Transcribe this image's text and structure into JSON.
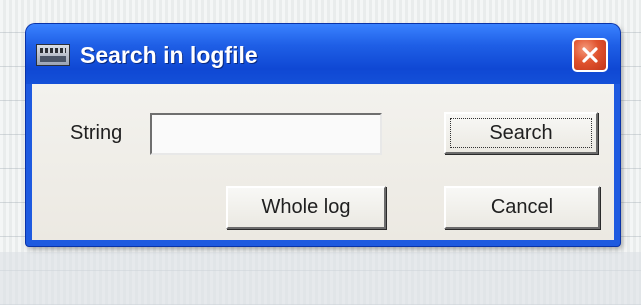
{
  "dialog": {
    "title": "Search in logfile",
    "string_label": "String",
    "string_value": "",
    "buttons": {
      "search": "Search",
      "whole_log": "Whole log",
      "cancel": "Cancel"
    }
  },
  "icons": {
    "app": "app-window-icon",
    "close": "close-icon"
  },
  "colors": {
    "titlebar": "#1f5fe6",
    "close": "#e0532e",
    "client": "#ece9e2"
  }
}
